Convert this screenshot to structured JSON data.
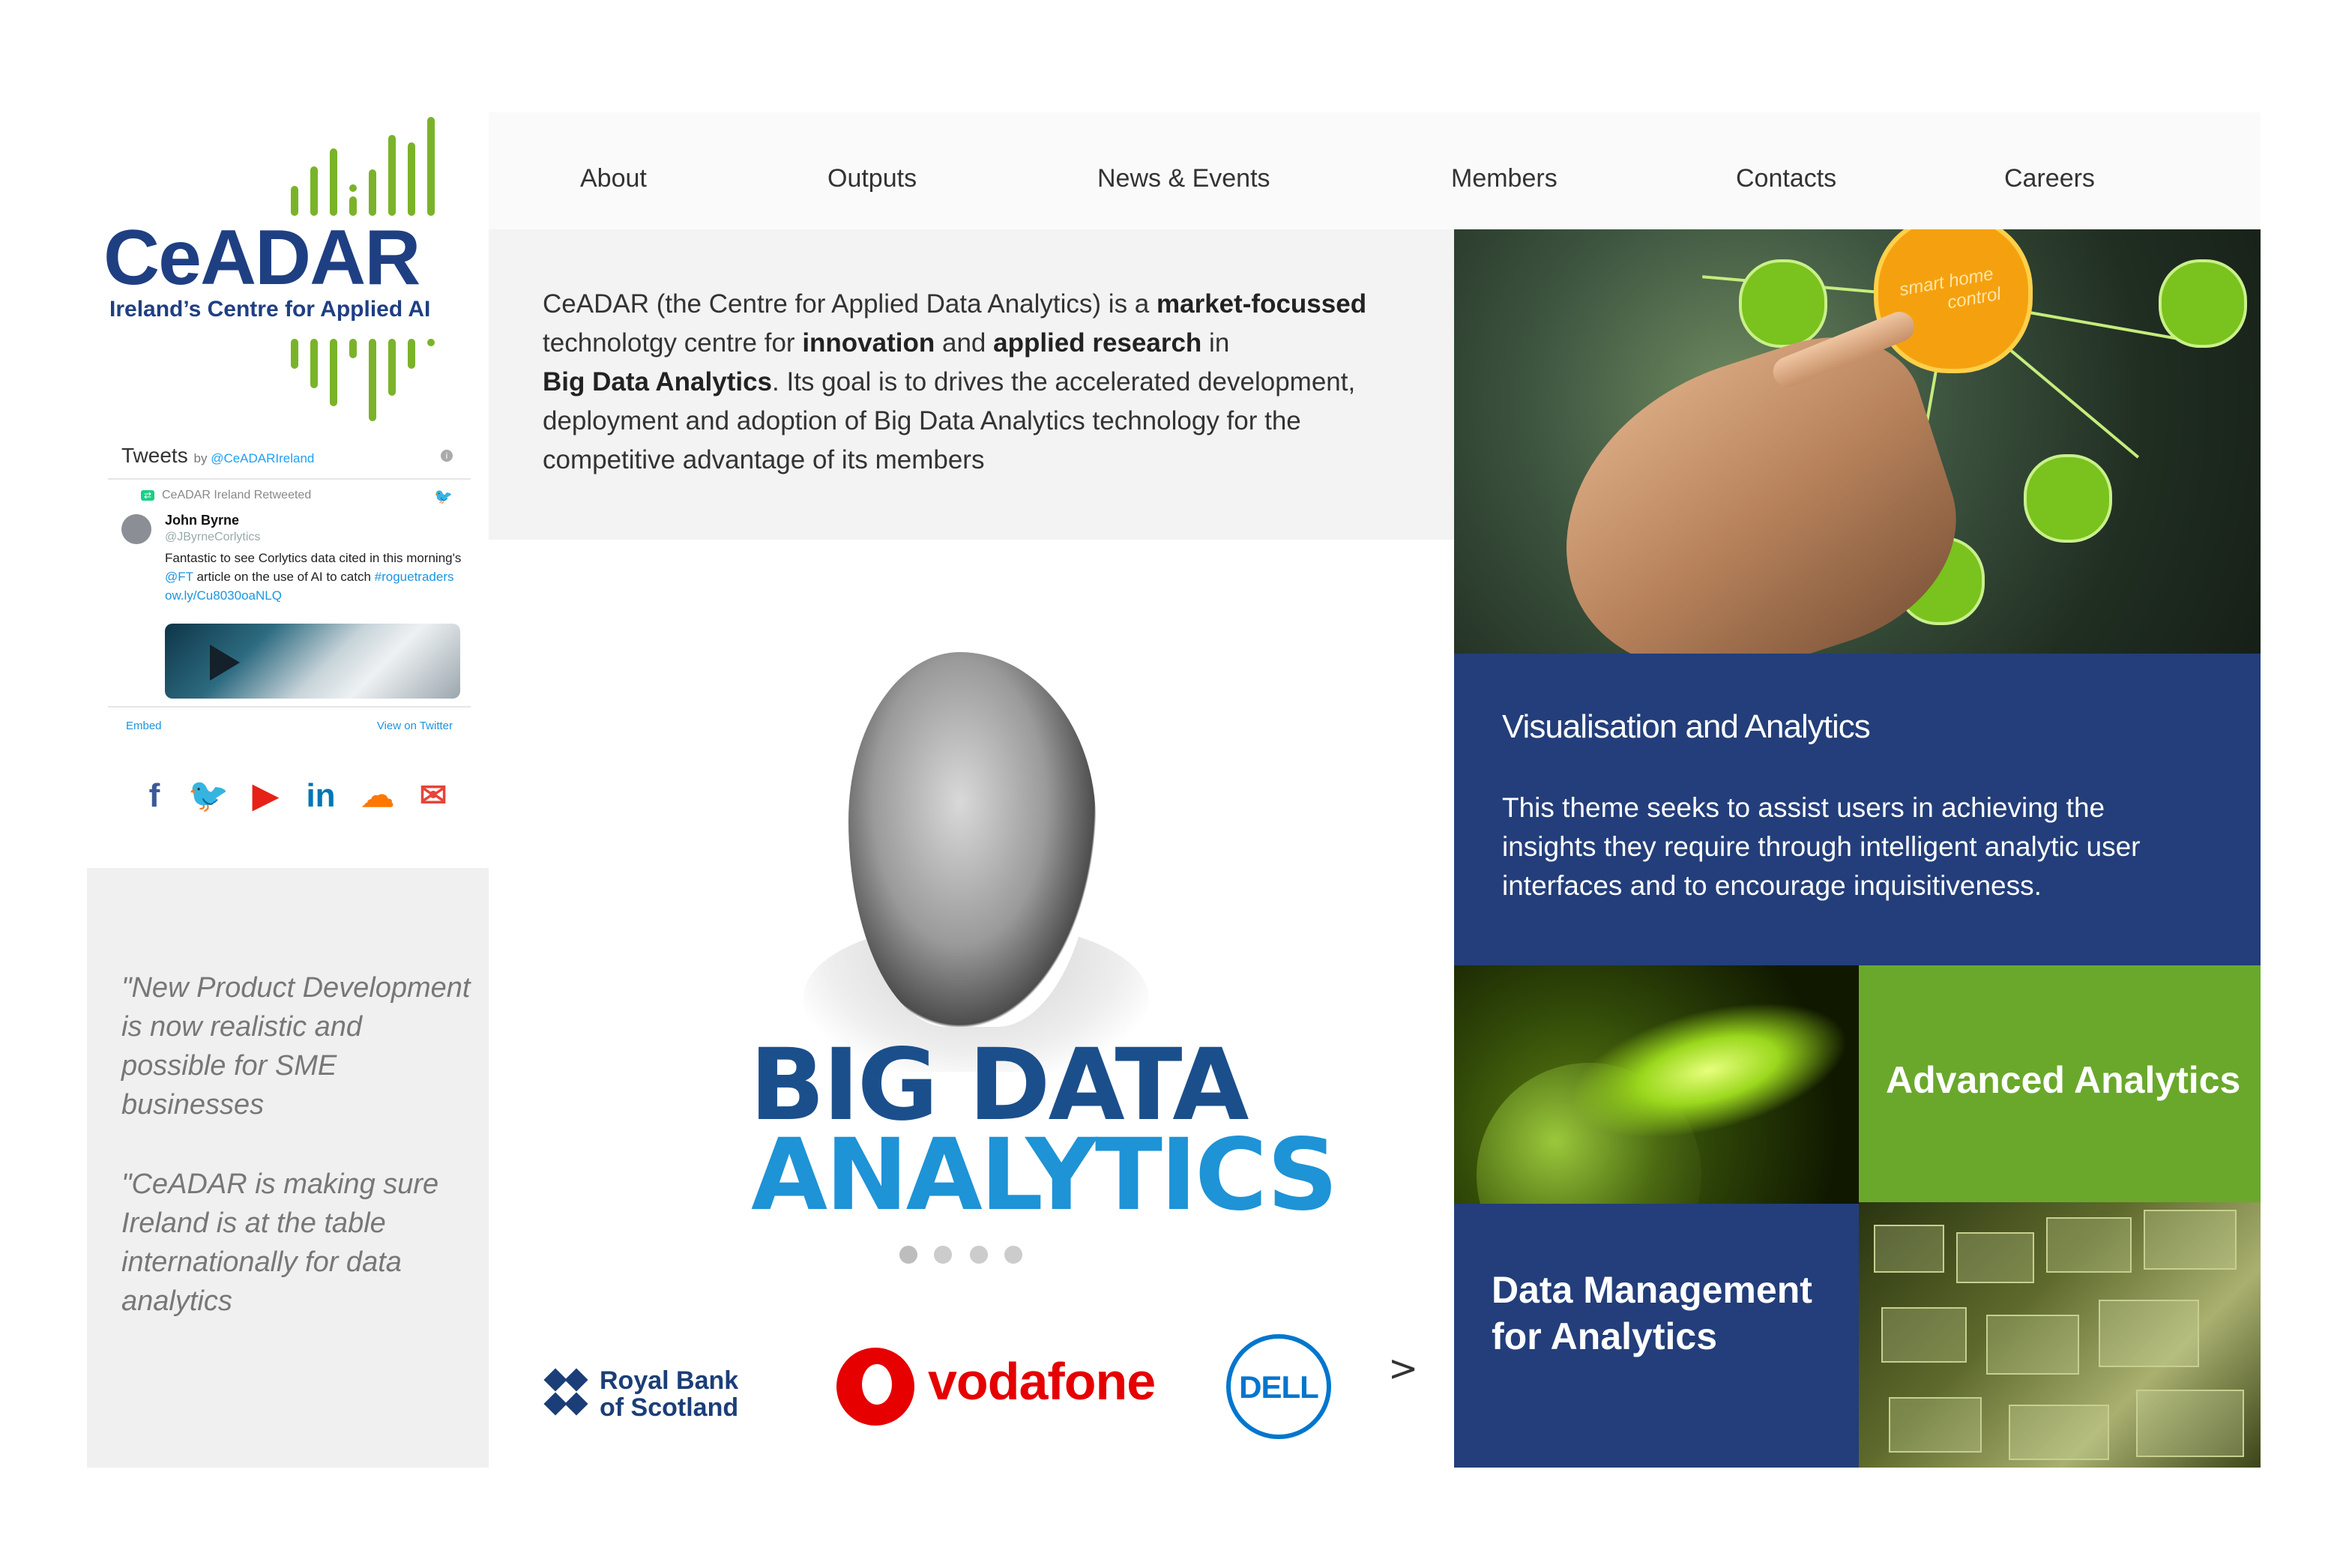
{
  "logo": {
    "name": "CeADAR",
    "tagline": "Ireland’s Centre for Applied AI",
    "accent_color": "#7ab32a",
    "brand_color": "#1f3f83"
  },
  "tweets": {
    "title": "Tweets",
    "by": "by",
    "handle": "@CeADARIreland",
    "retweet_label": "CeADAR Ireland Retweeted",
    "user_name": "John Byrne",
    "user_handle": "@JByrneCorlytics",
    "text_1": "Fantastic to see Corlytics data cited in this morning's ",
    "mention": "@FT",
    "text_2": " article on the use of AI to catch ",
    "hashtag": "#roguetraders",
    "link": " ow.ly/Cu8030oaNLQ",
    "embed_label": "Embed",
    "view_label": "View on Twitter"
  },
  "social": [
    {
      "icon": "facebook-icon",
      "glyph": "f",
      "color": "#3b5998"
    },
    {
      "icon": "twitter-icon",
      "glyph": "🐦",
      "color": "#1da1f2"
    },
    {
      "icon": "youtube-icon",
      "glyph": "▶",
      "color": "#e62117"
    },
    {
      "icon": "linkedin-icon",
      "glyph": "in",
      "color": "#0077b5"
    },
    {
      "icon": "soundcloud-icon",
      "glyph": "☁",
      "color": "#ff7700"
    },
    {
      "icon": "mail-icon",
      "glyph": "✉",
      "color": "#e4463a"
    }
  ],
  "quotes": {
    "quote_1": "\"New Product Development is now realistic and possible  for SME businesses",
    "quote_2": "\"CeADAR is making sure Ireland is at the table internationally for data analytics"
  },
  "nav": {
    "items": [
      "About",
      "Outputs",
      "News & Events",
      "Members",
      "Contacts",
      "Careers"
    ]
  },
  "intro": {
    "p1": "CeADAR (the Centre for Applied Data Analytics) is a ",
    "b1": "market-focussed",
    "p2": " technolotgy centre for ",
    "b2": "innovation",
    "p3": " and ",
    "b3": "applied research",
    "p4": " in ",
    "b4": "Big Data Analytics",
    "p5": ".  Its goal is to drives the accelerated development, deployment and adoption of Big Data Analytics technology for the competitive advantage of its members"
  },
  "carousel": {
    "slide_line_1": "BIG DATA",
    "slide_line_2": "ANALYTICS",
    "dot_count": 4,
    "active_dot": 0
  },
  "partners": {
    "rbs_line_1": "Royal Bank",
    "rbs_line_2": "of Scotland",
    "vodafone": "vodafone",
    "dell": "DELL",
    "next_label": ">"
  },
  "tiles": {
    "photo_label_1": "smart home",
    "photo_label_2": "control",
    "vis_title": "Visualisation and Analytics",
    "vis_text": "This theme seeks to assist users in achieving  the insights they require through intelligent  analytic user interfaces and to encourage  inquisitiveness.",
    "adv_title": "Advanced Analytics",
    "dm_title": "Data Management for Analytics",
    "blue_color": "#233e7a",
    "green_color": "#6aa82c"
  }
}
